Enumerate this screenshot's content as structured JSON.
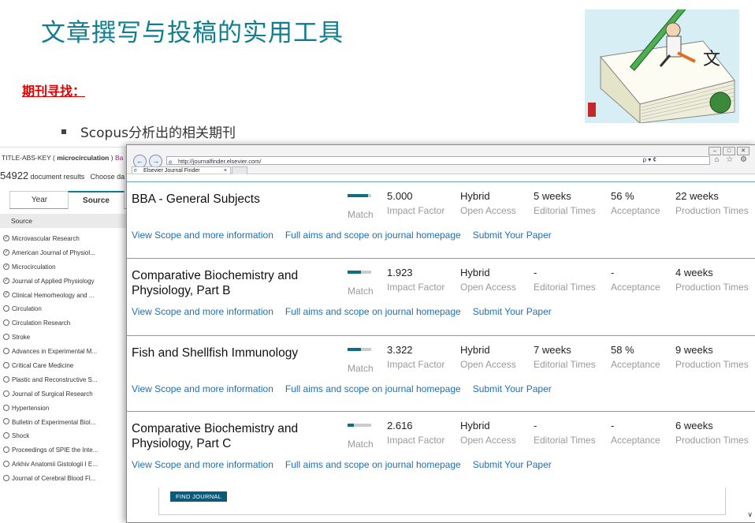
{
  "slide": {
    "title": "文章撰写与投稿的实用工具",
    "heading": "期刊寻找：",
    "bullet": "Scopus分析出的相关期刊"
  },
  "scopus": {
    "query_prefix": "TITLE-ABS-KEY (",
    "query_term": " microcirculation ",
    "query_suffix": ")",
    "query_extra": "Ba",
    "count": "54922",
    "count_label": " document results",
    "choose": "Choose da",
    "tabs": [
      "Year",
      "Source"
    ],
    "source_header": "Source",
    "sources": [
      {
        "label": "Microvascular Research",
        "checked": true
      },
      {
        "label": "American Journal of Physiol...",
        "checked": true
      },
      {
        "label": "Microcirculation",
        "checked": true
      },
      {
        "label": "Journal of Applied Physiology",
        "checked": true
      },
      {
        "label": "Clinical Hemorheology and ...",
        "checked": true
      },
      {
        "label": "Circulation",
        "checked": false
      },
      {
        "label": "Circulation Research",
        "checked": false
      },
      {
        "label": "Stroke",
        "checked": false
      },
      {
        "label": "Advances in Experimental M...",
        "checked": false
      },
      {
        "label": "Critical Care Medicine",
        "checked": false
      },
      {
        "label": "Plastic and Reconstructive S...",
        "checked": false
      },
      {
        "label": "Journal of Surgical Research",
        "checked": false
      },
      {
        "label": "Hypertension",
        "checked": false
      },
      {
        "label": "Bulletin of Experimental Biol...",
        "checked": false
      },
      {
        "label": "Shock",
        "checked": false
      },
      {
        "label": "Proceedings of SPIE the Inte...",
        "checked": false
      },
      {
        "label": "Arkhiv Anatomii Gistologii I E...",
        "checked": false
      },
      {
        "label": "Journal of Cerebral Blood Fl...",
        "checked": false
      }
    ]
  },
  "browser": {
    "url": "http://journalfinder.elsevier.com/",
    "tab_title": "Elsevier Journal Finder",
    "url_tools": "ρ ▾ ¢",
    "chrome_icons": "⌂ ☆ ⚙"
  },
  "labels": {
    "match": "Match",
    "impact": "Impact Factor",
    "open_access": "Open Access",
    "editorial": "Editorial Times",
    "acceptance": "Acceptance",
    "production": "Production Times",
    "link_scope": "View Scope and more information",
    "link_aims": "Full aims and scope on journal homepage",
    "link_submit": "Submit Your Paper"
  },
  "journals": [
    {
      "name": "BBA - General Subjects",
      "match": 0.85,
      "impact": "5.000",
      "access": "Hybrid",
      "editorial": "5 weeks",
      "acceptance": "56 %",
      "production": "22 weeks"
    },
    {
      "name": "Comparative Biochemistry and Physiology, Part B",
      "match": 0.55,
      "impact": "1.923",
      "access": "Hybrid",
      "editorial": "-",
      "acceptance": "-",
      "production": "4 weeks"
    },
    {
      "name": "Fish and Shellfish Immunology",
      "match": 0.55,
      "impact": "3.322",
      "access": "Hybrid",
      "editorial": "7 weeks",
      "acceptance": "58 %",
      "production": "9 weeks"
    },
    {
      "name": "Comparative Biochemistry and Physiology, Part C",
      "match": 0.25,
      "impact": "2.616",
      "access": "Hybrid",
      "editorial": "-",
      "acceptance": "-",
      "production": "6 weeks"
    }
  ],
  "find_button": "FIND JOURNAL",
  "colors": {
    "title": "#0f7d92",
    "heading": "#e00000",
    "link": "#1d6fb8",
    "bar": "#0f6e82"
  }
}
